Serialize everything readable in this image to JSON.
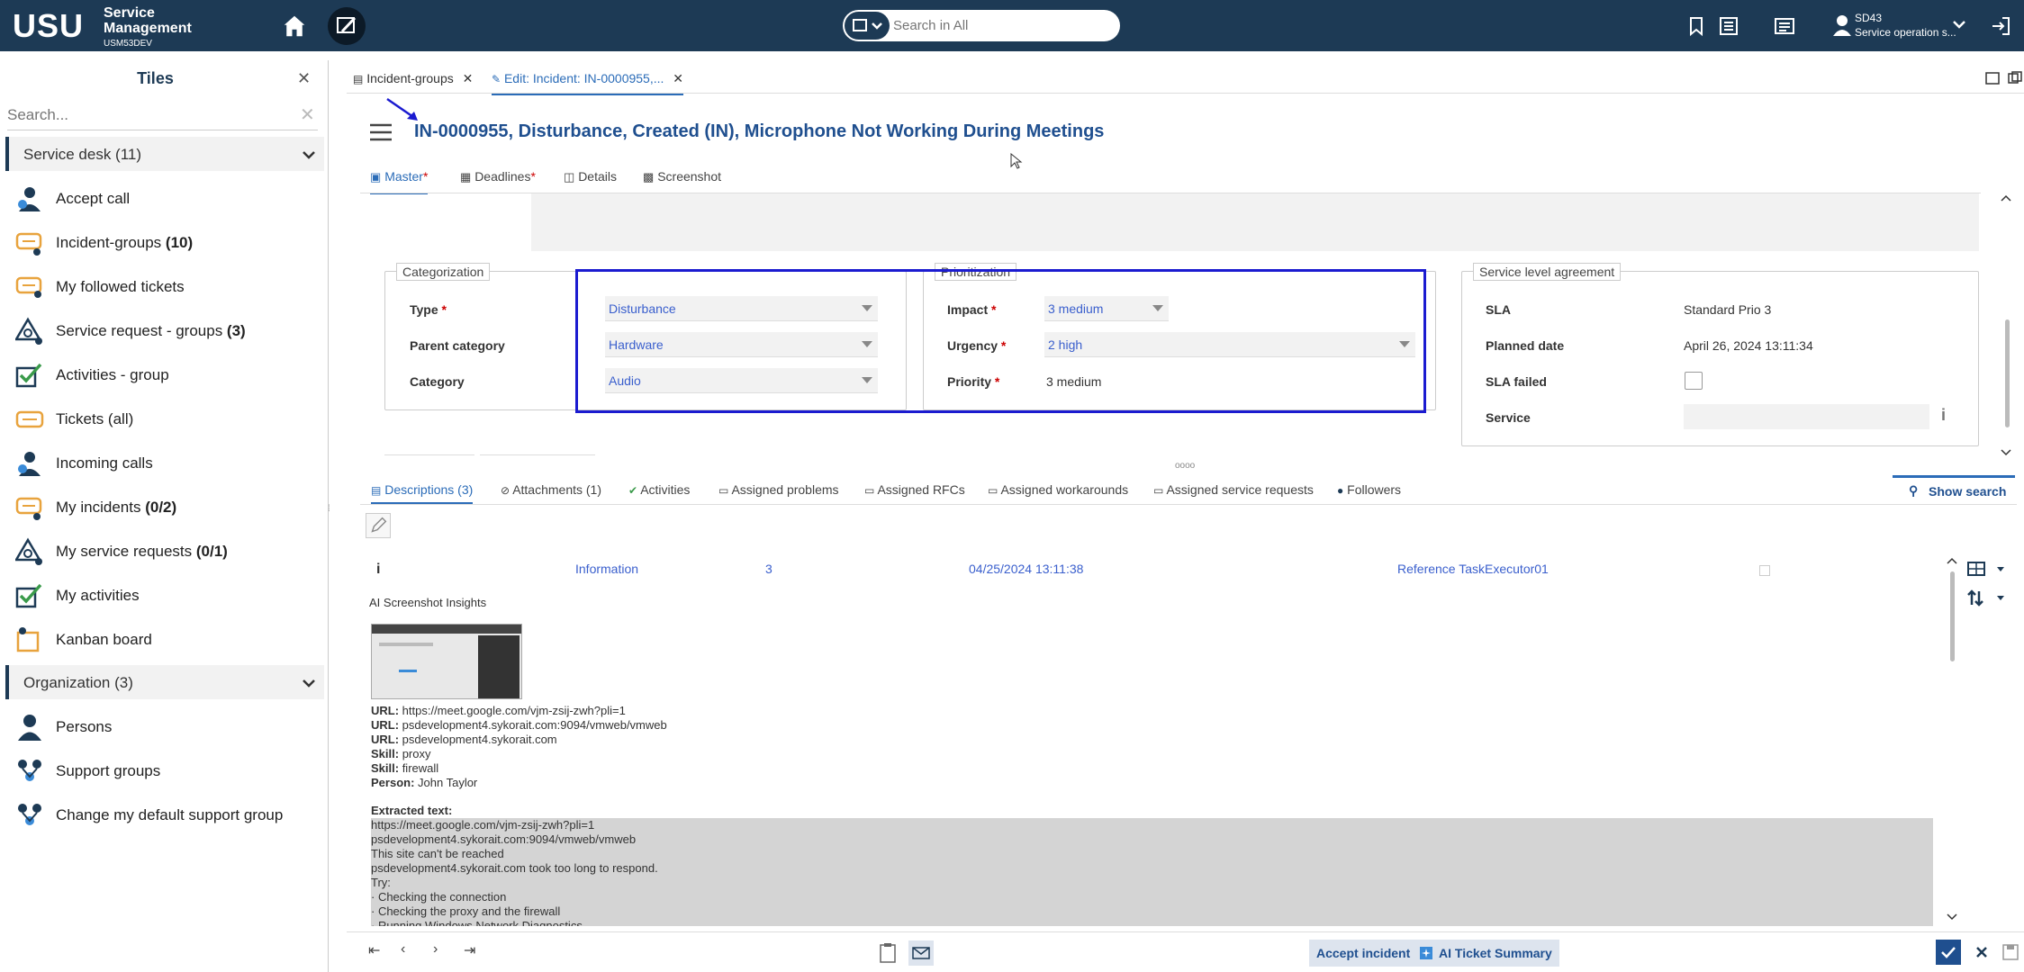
{
  "topbar": {
    "logo": "USU",
    "brand_line1": "Service",
    "brand_line2": "Management",
    "brand_sub": "USM53DEV",
    "search_placeholder": "Search in All",
    "user_name": "SD43",
    "user_role": "Service operation s..."
  },
  "tiles": {
    "title": "Tiles",
    "search_placeholder": "Search...",
    "groups": [
      {
        "label": "Service desk (11)"
      },
      {
        "label": "Organization (3)"
      }
    ],
    "items": [
      {
        "label": "Accept call",
        "count": ""
      },
      {
        "label": "Incident-groups ",
        "count": "(10)"
      },
      {
        "label": "My followed tickets",
        "count": ""
      },
      {
        "label": "Service request - groups ",
        "count": "(3)"
      },
      {
        "label": "Activities - group",
        "count": ""
      },
      {
        "label": "Tickets (all)",
        "count": ""
      },
      {
        "label": "Incoming calls",
        "count": ""
      },
      {
        "label": "My incidents ",
        "count": "(0/2)"
      },
      {
        "label": "My service requests ",
        "count": "(0/1)"
      },
      {
        "label": "My activities",
        "count": ""
      },
      {
        "label": "Kanban board",
        "count": ""
      },
      {
        "label": "Persons",
        "count": ""
      },
      {
        "label": "Support groups",
        "count": ""
      },
      {
        "label": "Change my default support group",
        "count": ""
      }
    ]
  },
  "tabs": [
    {
      "label": "Incident-groups"
    },
    {
      "label": "Edit: Incident: IN-0000955,..."
    }
  ],
  "page_title": "IN-0000955, Disturbance, Created (IN), Microphone Not Working During Meetings",
  "subtabs": [
    {
      "label": "Master",
      "req": "*"
    },
    {
      "label": "Deadlines",
      "req": "*"
    },
    {
      "label": "Details",
      "req": ""
    },
    {
      "label": "Screenshot",
      "req": ""
    }
  ],
  "categorization": {
    "legend": "Categorization",
    "type_label": "Type",
    "type_value": "Disturbance",
    "parent_label": "Parent category",
    "parent_value": "Hardware",
    "category_label": "Category",
    "category_value": "Audio"
  },
  "prioritization": {
    "legend": "Prioritization",
    "impact_label": "Impact",
    "impact_value": "3 medium",
    "urgency_label": "Urgency",
    "urgency_value": "2 high",
    "priority_label": "Priority",
    "priority_value": "3 medium"
  },
  "sla": {
    "legend": "Service level agreement",
    "sla_label": "SLA",
    "sla_value": "Standard Prio 3",
    "planned_label": "Planned date",
    "planned_value": "April 26, 2024 13:11:34",
    "failed_label": "SLA failed",
    "service_label": "Service"
  },
  "req_mark": "*",
  "bottom_tabs": [
    {
      "label": "Descriptions (3)"
    },
    {
      "label": "Attachments (1)"
    },
    {
      "label": "Activities"
    },
    {
      "label": "Assigned problems"
    },
    {
      "label": "Assigned RFCs"
    },
    {
      "label": "Assigned workarounds"
    },
    {
      "label": "Assigned service requests"
    },
    {
      "label": "Followers"
    }
  ],
  "show_search": "Show search",
  "desc_row": {
    "icon": "i",
    "type": "Information",
    "num": "3",
    "date": "04/25/2024 13:11:38",
    "ref": "Reference TaskExecutor01"
  },
  "ai_title": "AI Screenshot Insights",
  "insights": [
    {
      "key": "URL:",
      "val": " https://meet.google.com/vjm-zsij-zwh?pli=1"
    },
    {
      "key": "URL:",
      "val": " psdevelopment4.sykorait.com:9094/vmweb/vmweb"
    },
    {
      "key": "URL:",
      "val": " psdevelopment4.sykorait.com"
    },
    {
      "key": "Skill:",
      "val": " proxy"
    },
    {
      "key": "Skill:",
      "val": " firewall"
    },
    {
      "key": "Person:",
      "val": " John Taylor"
    }
  ],
  "extracted_label": "Extracted text:",
  "extracted_lines": [
    "https://meet.google.com/vjm-zsij-zwh?pli=1",
    "psdevelopment4.sykorait.com:9094/vmweb/vmweb",
    "This site can't be reached",
    "psdevelopment4.sykorait.com took too long to respond.",
    "Try:",
    "· Checking the connection",
    "· Checking the proxy and the firewall",
    "· Running Windows Network Diagnostics"
  ],
  "buttons": {
    "accept": "Accept incident",
    "summary": "AI Ticket Summary"
  }
}
